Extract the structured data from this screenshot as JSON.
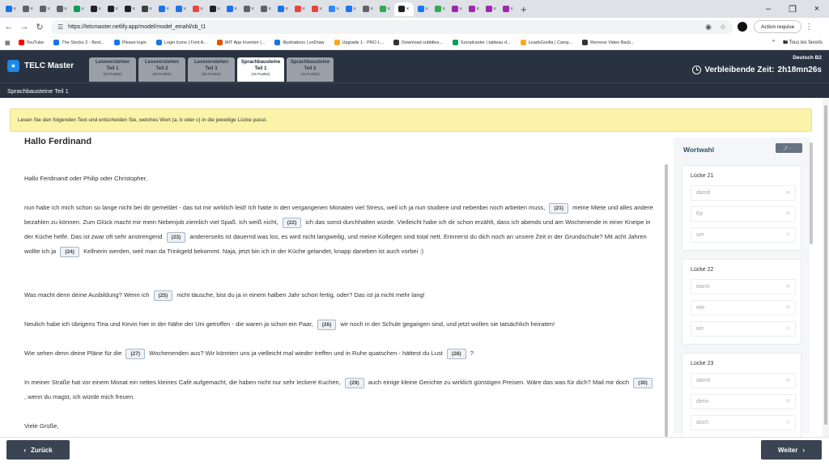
{
  "browser": {
    "tab_colors": [
      "#1a73e8",
      "#5f6368",
      "#5f6368",
      "#5f6368",
      "#0f9d58",
      "#202124",
      "#202124",
      "#202124",
      "#3c4043",
      "#1a73e8",
      "#1a73e8",
      "#e8453c",
      "#202124",
      "#1a73e8",
      "#5f6368",
      "#5f6368",
      "#1a73e8",
      "#e8453c",
      "#e8453c",
      "#2d88ff",
      "#1877f2",
      "#5f6368",
      "#34a853",
      "#202124",
      "#1877f2",
      "#34a853",
      "#9c27b0",
      "#9c27b0",
      "#9c27b0",
      "#9c27b0"
    ],
    "url": "https://telcmaster.netlify.app/model/model_einahl/sb_t1",
    "action_button": "Action requise",
    "bookmarks": [
      "YouTube",
      "The Stocks 2 - Best...",
      "Please login",
      "Login Icons | Font A...",
      "MIT App Inventor |...",
      "Illustrations | unDraw",
      "Upgrade 1 - PRO L...",
      "Download subtitles...",
      "Socialcaster | tableau d...",
      "LeadsGorilla | Camp...",
      "Remove Video Back..."
    ],
    "bookmark_colors": [
      "#ff0000",
      "#1a73e8",
      "#1a73e8",
      "#1a73e8",
      "#e65100",
      "#1a73e8",
      "#f9a825",
      "#333333",
      "#0f9d58",
      "#f9a825",
      "#333333"
    ],
    "all_bookmarks": "Tous les favoris"
  },
  "app": {
    "brand": "TELC Master",
    "level": "Deutsch B2",
    "timer_label": "Verbleibende Zeit:",
    "timer_value": "2h18mn26s",
    "section_title": "Sprachbausteine Teil 1",
    "tabs": [
      {
        "title": "Leseverstehen",
        "part": "Teil 1",
        "points": "(25 Punkte)"
      },
      {
        "title": "Leseverstehen",
        "part": "Teil 2",
        "points": "(25 Punkte)"
      },
      {
        "title": "Leseverstehen",
        "part": "Teil 3",
        "points": "(25 Punkte)"
      },
      {
        "title": "Sprachbausteine",
        "part": "Teil 1",
        "points": "(15 Punkte)"
      },
      {
        "title": "Sprachbausteine",
        "part": "Teil 2",
        "points": "(15 Punkte)"
      }
    ]
  },
  "instruction": "Lesen Sie den folgenden Text und entscheiden Sie, welches Wort (a, b oder c) in die jeweilige Lücke passt.",
  "letter": {
    "title": "Hallo Ferdinand",
    "salutation": "Hallo Ferdinand oder Philip oder Christopher,",
    "p1": {
      "a": "nun habe ich mich schon so lange nicht bei dir gemeldet - das tut mir wirklich leid! Ich hatte in den vergangenen Monaten viel Stress, weil ich ja nun studiere und nebenbei noch arbeiten muss,",
      "g21": "(21)",
      "b": "meine Miete und alles andere bezahlen zu können. Zum Glück macht mir mein Nebenjob ziemlich viel Spaß. Ich weiß nicht,",
      "g22": "(22)",
      "c": "ich das sonst durchhalten würde. Vielleicht habe ich dir schon erzählt, dass ich abends und am Wochenende in einer Kneipe in der Küche helfe. Das ist zwar oft sehr anstrengend",
      "g23": "(23)",
      "d": "andererseits ist dauernd was los, es wird nicht langweilig, und meine Kollegen sind total nett. Erinnerst du dich noch an unsere Zeit in der Grundschule? Mit acht Jahren wollte ich ja",
      "g24": "(24)",
      "e": "Kellnerin werden, weil man da Trinkgeld bekommt. Naja, jetzt bin ich in der Küche gelandet, knapp daneben ist auch vorbei :)"
    },
    "p2": {
      "a": "Was macht denn deine Ausbildung? Wenn ich",
      "g25": "(25)",
      "b": "nicht täusche, bist du ja in einem halben Jahr schon fertig, oder? Das ist ja nicht mehr lang!"
    },
    "p3": {
      "a": "Neulich habe ich übrigens Tina und Kevin hier in der Nähe der Uni getroffen - die waren ja schon ein Paar,",
      "g26": "(26)",
      "b": "wir noch in der Schule gegangen sind, und jetzt wollen sie tatsächlich heiraten!"
    },
    "p4": {
      "a": "Wie sehen denn deine Pläne für die",
      "g27": "(27)",
      "b": "Wochenenden aus? Wir könnten uns ja vielleicht mal wieder treffen und in Ruhe quatschen - hättest du Lust",
      "g28": "(28)",
      "c": "?"
    },
    "p5": {
      "a": "In meiner Straße hat vor einem Monat ein nettes kleines Café aufgemacht, die haben nicht nur sehr leckere Kuchen,",
      "g29": "(29)",
      "b": "auch einige kleine Gerichte zu wirklich günstigen Preisen. Wäre das was für dich? Mail mir doch",
      "g30": "(30)",
      "c": ", wenn du magst, ich würde mich freuen."
    },
    "closing": "Viele Grüße,"
  },
  "wortwahl": {
    "title": "Wortwahl",
    "button": "⤴ · · ·",
    "cards": [
      {
        "title": "Lücke 21",
        "options": [
          {
            "text": "damit",
            "key": "a)"
          },
          {
            "text": "für",
            "key": "b)"
          },
          {
            "text": "um",
            "key": "c)"
          }
        ]
      },
      {
        "title": "Lücke 22",
        "options": [
          {
            "text": "wann",
            "key": "a)"
          },
          {
            "text": "wie",
            "key": "b)"
          },
          {
            "text": "wo",
            "key": "c)"
          }
        ]
      },
      {
        "title": "Lücke 23",
        "options": [
          {
            "text": "damit",
            "key": "a)"
          },
          {
            "text": "denn",
            "key": "b)"
          },
          {
            "text": "doch",
            "key": "c)"
          }
        ]
      }
    ]
  },
  "footer": {
    "back": "Zurück",
    "next": "Weiter"
  },
  "icons": {
    "chevron_left": "‹",
    "chevron_right": "›",
    "back_arrow": "←",
    "forward_arrow": "→",
    "reload": "↻",
    "star": "☆",
    "close": "×",
    "plus": "+",
    "kebab": "⋮"
  }
}
